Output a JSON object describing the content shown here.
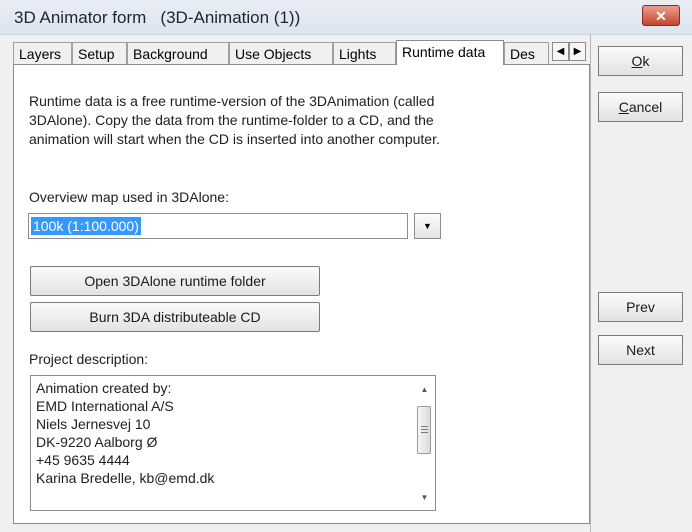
{
  "window": {
    "title": "3D Animator form   (3D-Animation (1))",
    "close_glyph": "✕"
  },
  "tabs": [
    {
      "label": "Layers"
    },
    {
      "label": "Setup"
    },
    {
      "label": "Background"
    },
    {
      "label": "Use Objects"
    },
    {
      "label": "Lights"
    },
    {
      "label": "Runtime data",
      "active": true
    },
    {
      "label": "Des"
    }
  ],
  "tab_scroll": {
    "left": "◀",
    "right": "▶"
  },
  "runtime": {
    "description": "Runtime data is a free runtime-version of the 3DAnimation (called 3DAlone). Copy the data from the runtime-folder to a CD, and the animation will start when the CD is inserted into another computer.",
    "overview_map_label": "Overview map used in 3DAlone:",
    "overview_map_value": "100k (1:100.000)",
    "dropdown_glyph": "▼",
    "open_folder_button": "Open 3DAlone runtime folder",
    "burn_cd_button": "Burn 3DA distributeable CD",
    "project_description_label": "Project description:",
    "project_description_lines": [
      "Animation created by:",
      "EMD International A/S",
      "Niels Jernesvej 10",
      "DK-9220 Aalborg Ø",
      "+45 9635 4444",
      "Karina Bredelle, kb@emd.dk"
    ],
    "scroll_up": "▲",
    "scroll_down": "▼"
  },
  "side_buttons": {
    "ok": {
      "mnemonic": "O",
      "rest": "k"
    },
    "cancel": {
      "mnemonic": "C",
      "rest": "ancel"
    },
    "prev": "Prev",
    "next": "Next"
  }
}
